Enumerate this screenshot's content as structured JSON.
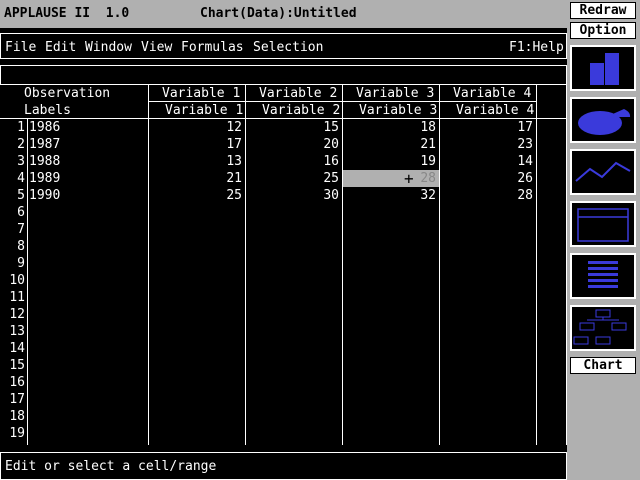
{
  "title": {
    "app": "APPLAUSE II  1.0",
    "doc": "Chart(Data):Untitled"
  },
  "menu": {
    "items": [
      "File",
      "Edit",
      "Window",
      "View",
      "Formulas",
      "Selection"
    ],
    "help": "F1:Help"
  },
  "header": {
    "obs_line1": "Observation",
    "obs_line2": "Labels",
    "variables": [
      {
        "top": "Variable 1",
        "bottom": "Variable 1"
      },
      {
        "top": "Variable 2",
        "bottom": "Variable 2"
      },
      {
        "top": "Variable 3",
        "bottom": "Variable 3"
      },
      {
        "top": "Variable 4",
        "bottom": "Variable 4"
      }
    ]
  },
  "rows": [
    {
      "num": "1",
      "label": "1986",
      "v": [
        "12",
        "15",
        "18",
        "17"
      ]
    },
    {
      "num": "2",
      "label": "1987",
      "v": [
        "17",
        "20",
        "21",
        "23"
      ]
    },
    {
      "num": "3",
      "label": "1988",
      "v": [
        "13",
        "16",
        "19",
        "14"
      ]
    },
    {
      "num": "4",
      "label": "1989",
      "v": [
        "21",
        "25",
        "28",
        "26"
      ]
    },
    {
      "num": "5",
      "label": "1990",
      "v": [
        "25",
        "30",
        "32",
        "28"
      ]
    },
    {
      "num": "6",
      "label": "",
      "v": [
        "",
        "",
        "",
        ""
      ]
    },
    {
      "num": "7",
      "label": "",
      "v": [
        "",
        "",
        "",
        ""
      ]
    },
    {
      "num": "8",
      "label": "",
      "v": [
        "",
        "",
        "",
        ""
      ]
    },
    {
      "num": "9",
      "label": "",
      "v": [
        "",
        "",
        "",
        ""
      ]
    },
    {
      "num": "10",
      "label": "",
      "v": [
        "",
        "",
        "",
        ""
      ]
    },
    {
      "num": "11",
      "label": "",
      "v": [
        "",
        "",
        "",
        ""
      ]
    },
    {
      "num": "12",
      "label": "",
      "v": [
        "",
        "",
        "",
        ""
      ]
    },
    {
      "num": "13",
      "label": "",
      "v": [
        "",
        "",
        "",
        ""
      ]
    },
    {
      "num": "14",
      "label": "",
      "v": [
        "",
        "",
        "",
        ""
      ]
    },
    {
      "num": "15",
      "label": "",
      "v": [
        "",
        "",
        "",
        ""
      ]
    },
    {
      "num": "16",
      "label": "",
      "v": [
        "",
        "",
        "",
        ""
      ]
    },
    {
      "num": "17",
      "label": "",
      "v": [
        "",
        "",
        "",
        ""
      ]
    },
    {
      "num": "18",
      "label": "",
      "v": [
        "",
        "",
        "",
        ""
      ]
    },
    {
      "num": "19",
      "label": "",
      "v": [
        "",
        "",
        "",
        ""
      ]
    }
  ],
  "status": "Edit or select a cell/range",
  "side": {
    "redraw": "Redraw",
    "option": "Option",
    "chart": "Chart",
    "tools": [
      "bar-chart-icon",
      "pie-chart-icon",
      "line-chart-icon",
      "window-icon",
      "text-list-icon",
      "org-chart-icon"
    ]
  },
  "colors": {
    "accent": "#3a3adb",
    "panel": "#b0b0b0"
  }
}
